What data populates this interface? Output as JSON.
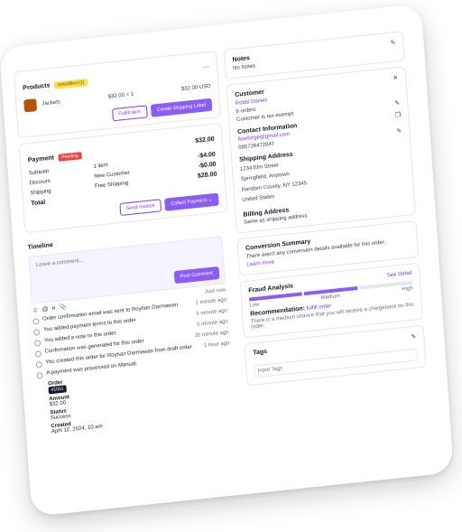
{
  "products": {
    "title": "Products",
    "status_badge": "Unfulfilled (1)",
    "item": {
      "name": "Jackets",
      "unit_price": "$32.00 × 1",
      "total": "$32.00 USD"
    },
    "fulfill_label": "Fulfill item",
    "shipping_label": "Create Shipping Label",
    "more": "⋯"
  },
  "payment": {
    "title": "Payment",
    "status_badge": "Pending",
    "top_amount": "$32.00",
    "rows": [
      {
        "label": "Subtotal",
        "desc": "1 item",
        "value": "-$4.00"
      },
      {
        "label": "Discount",
        "desc": "New Customer",
        "value": "-$0.00"
      },
      {
        "label": "Shipping",
        "desc": "Free Shipping",
        "value": "$28.00"
      },
      {
        "label": "Total",
        "desc": "",
        "value": ""
      }
    ],
    "send_invoice_label": "Send Invoice",
    "collect_label": "Collect Payment"
  },
  "timeline": {
    "title": "Timeline",
    "comment_placeholder": "Leave a comment...",
    "post_label": "Post Comment",
    "items": [
      {
        "text": "",
        "time": "Just now"
      },
      {
        "text": "Order confirmation email was sent to Royhan Darmawan",
        "time": "1 minute ago"
      },
      {
        "text": "You added payment terms to this order",
        "time": "5 minute ago"
      },
      {
        "text": "You added a note to this order.",
        "time": "5 minute ago"
      },
      {
        "text": "Confirmation was generated for this order",
        "time": "20 minute ago"
      },
      {
        "text": "You created this order for Royhan Darmawan from draft order",
        "time": "1 hour ago"
      },
      {
        "text": "A payment was processed on Manual.",
        "time": ""
      }
    ],
    "details": {
      "order_label": "Order",
      "order_value": "#1001",
      "amount_label": "Amount",
      "amount_value": "$32.00",
      "status_label": "Status",
      "status_value": "Success",
      "created_label": "Created",
      "created_value": "April 12, 2024, 10 am"
    }
  },
  "notes": {
    "title": "Notes",
    "value": "No Notes"
  },
  "customer": {
    "title": "Customer",
    "name": "Robbi Darwis",
    "orders": "6 orders",
    "tax": "Customer is tax-exempt",
    "contact_title": "Contact Information",
    "email": "flowforge@gmail.com",
    "phone": "085728472847",
    "shipping_title": "Shipping Address",
    "address": [
      "1234 Elm Street",
      "Springfield, Anytown",
      "Random County, NY 12345",
      "United States"
    ],
    "billing_title": "Billing Address",
    "billing_value": "Same as shipping address"
  },
  "conversion": {
    "title": "Conversion Summary",
    "text": "There aren't any conversion details available for this order.",
    "link": "Learn more"
  },
  "fraud": {
    "title": "Fraud Analysis",
    "link": "See Detail",
    "levels": [
      "Low",
      "Medium",
      "High"
    ],
    "level_value": 0.66,
    "rec_label": "Recommendation:",
    "rec_value": "fulfill order",
    "note": "There is a medium chance that you will receive a chargeback on this order."
  },
  "tags": {
    "title": "Tags",
    "placeholder": "Input Tags"
  }
}
